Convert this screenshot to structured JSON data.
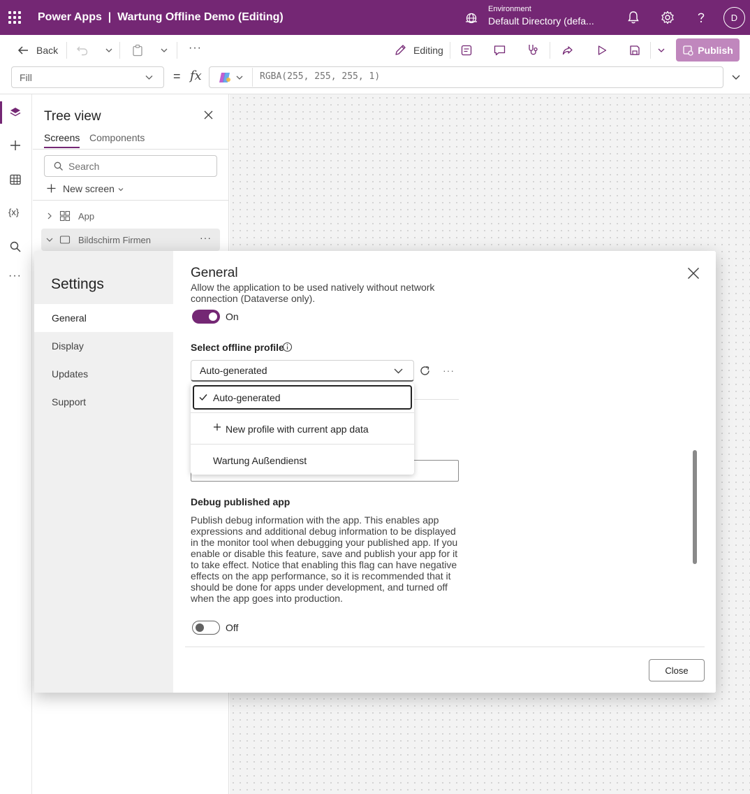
{
  "topbar": {
    "app_title": "Power Apps  |  Wartung Offline Demo (Editing)",
    "env_label": "Environment",
    "env_name": "Default Directory (defa...",
    "avatar_initial": "D",
    "color": "#742774"
  },
  "cmdbar": {
    "back_label": "Back",
    "editing_label": "Editing",
    "publish_label": "Publish"
  },
  "formula": {
    "property": "Fill",
    "equals": "=",
    "fx": "fx",
    "expression": "RGBA(255, 255, 255, 1)"
  },
  "tree": {
    "title": "Tree view",
    "tabs": [
      "Screens",
      "Components"
    ],
    "search_placeholder": "Search",
    "new_screen": "New screen",
    "items": [
      {
        "label": "App"
      },
      {
        "label": "Bildschirm Firmen"
      }
    ]
  },
  "settings": {
    "title": "Settings",
    "nav": [
      "General",
      "Display",
      "Updates",
      "Support"
    ],
    "section_title": "General",
    "offline_desc": "Allow the application to be used natively without network connection (Dataverse only).",
    "offline_toggle": "On",
    "profile_label": "Select offline profile",
    "profile_value": "Auto-generated",
    "dropdown_options": [
      "Auto-generated",
      "New profile with current app data",
      "Wartung Außendienst"
    ],
    "debug_title": "Debug published app",
    "debug_desc": "Publish debug information with the app. This enables app expressions and additional debug information to be displayed in the monitor tool when debugging your published app. If you enable or disable this feature, save and publish your app for it to take effect. Notice that enabling this flag can have negative effects on the app performance, so it is recommended that it should be done for apps under development, and turned off when the app goes into production.",
    "debug_toggle": "Off",
    "close_label": "Close"
  }
}
